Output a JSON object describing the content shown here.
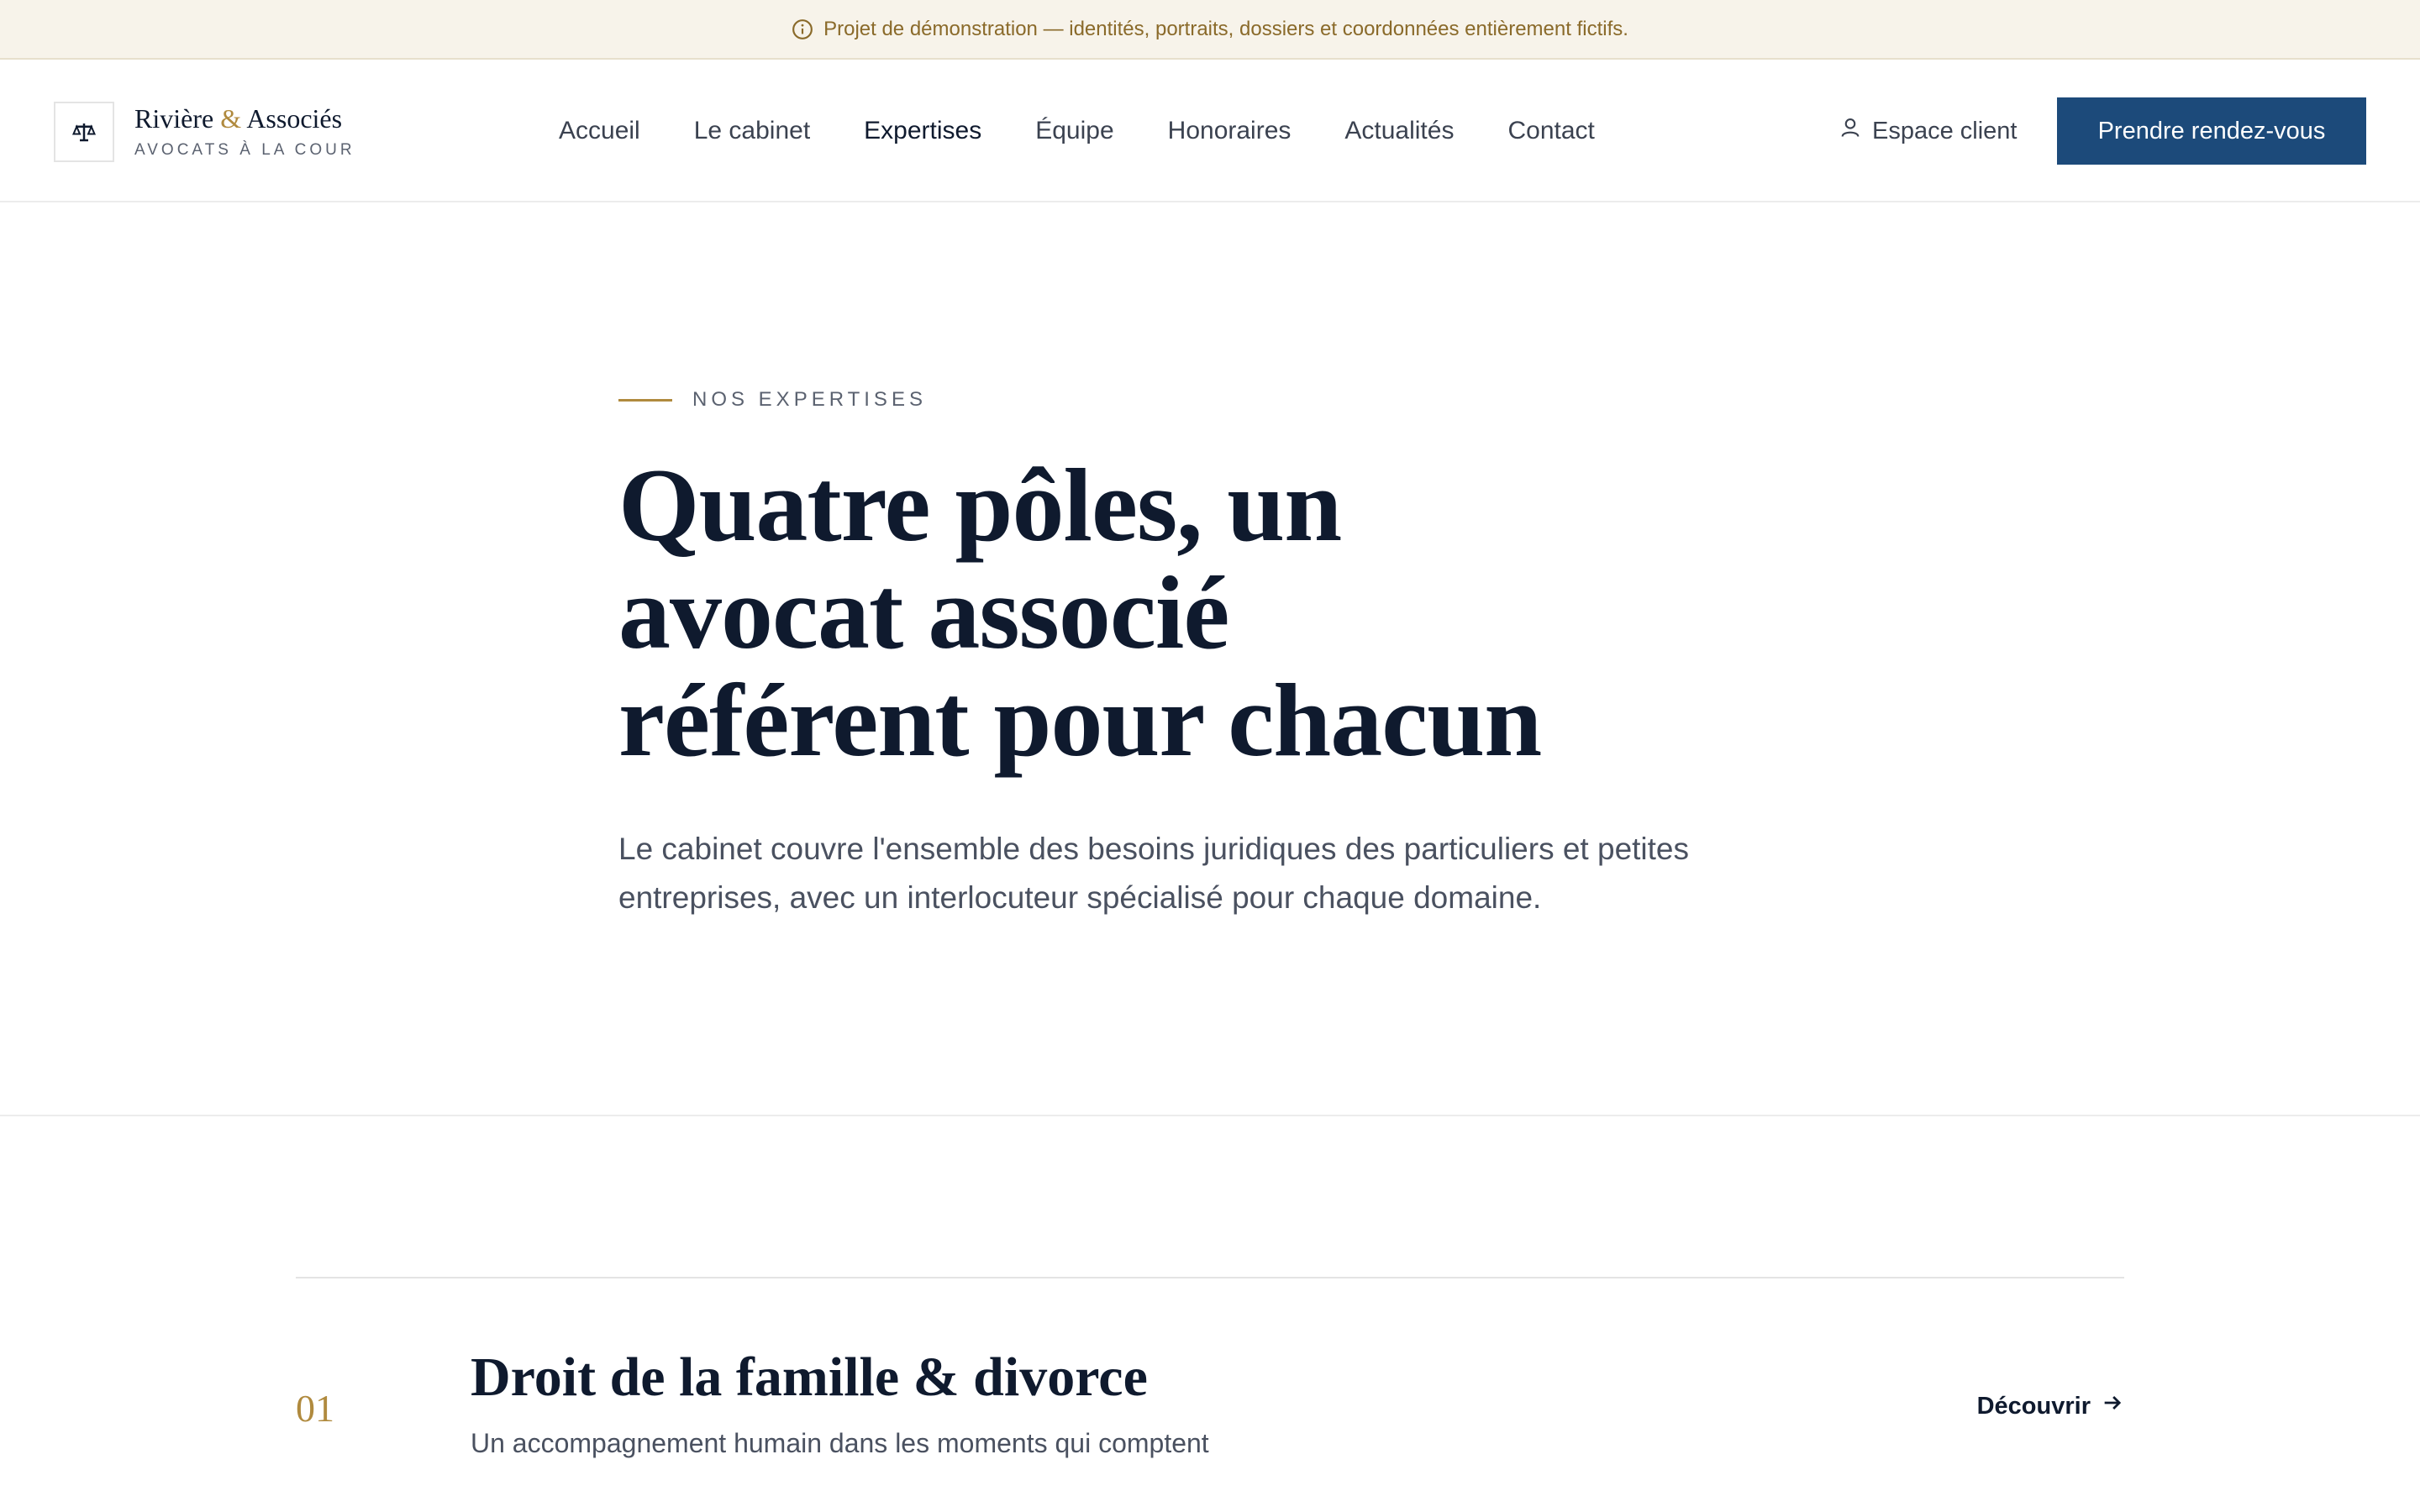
{
  "banner": {
    "text": "Projet de démonstration — identités, portraits, dossiers et coordonnées entièrement fictifs."
  },
  "logo": {
    "name_part1": "Rivière",
    "amp": "&",
    "name_part2": "Associés",
    "tagline": "AVOCATS À LA COUR"
  },
  "nav": {
    "items": [
      {
        "label": "Accueil"
      },
      {
        "label": "Le cabinet"
      },
      {
        "label": "Expertises"
      },
      {
        "label": "Équipe"
      },
      {
        "label": "Honoraires"
      },
      {
        "label": "Actualités"
      },
      {
        "label": "Contact"
      }
    ],
    "active": "Expertises"
  },
  "header": {
    "client_label": "Espace client",
    "cta_label": "Prendre rendez-vous"
  },
  "hero": {
    "eyebrow": "NOS EXPERTISES",
    "title_line1": "Quatre pôles, un",
    "title_line2": "avocat associé",
    "title_line3": "référent pour chacun",
    "lead": "Le cabinet couvre l'ensemble des besoins juridiques des particuliers et petites entreprises, avec un interlocuteur spécialisé pour chaque domaine."
  },
  "expertises": [
    {
      "number": "01",
      "title": "Droit de la famille & divorce",
      "description": "Un accompagnement humain dans les moments qui comptent",
      "link_label": "Découvrir"
    }
  ],
  "colors": {
    "accent_gold": "#b08a3e",
    "brand_blue": "#1c4a7a",
    "ink": "#0f1a2e"
  }
}
